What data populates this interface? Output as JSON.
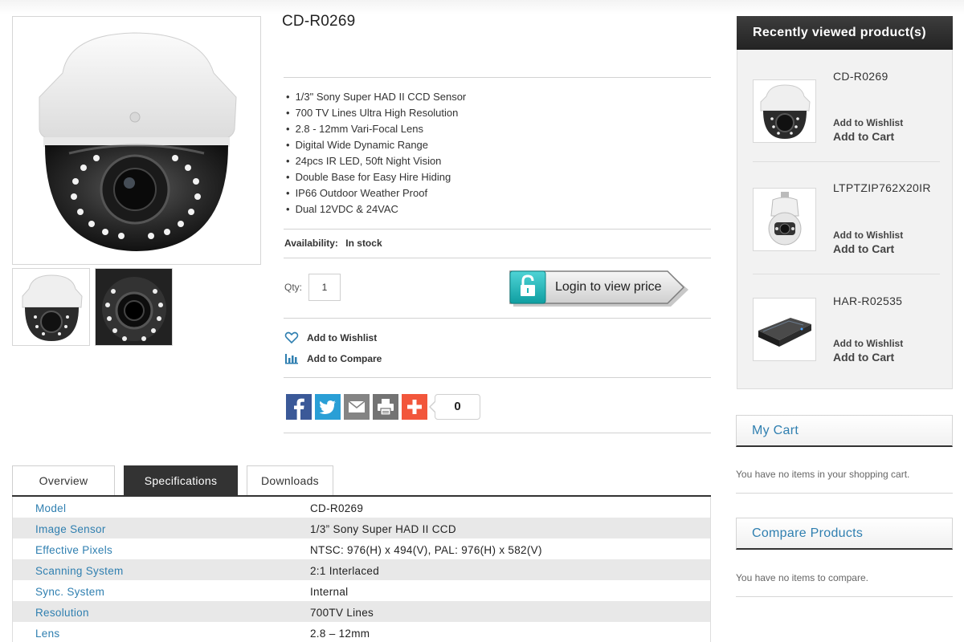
{
  "product": {
    "title": "CD-R0269",
    "features": [
      "1/3\" Sony Super HAD II CCD Sensor",
      "700 TV Lines Ultra High Resolution",
      "2.8 - 12mm Vari-Focal Lens",
      "Digital Wide Dynamic Range",
      "24pcs IR LED, 50ft Night Vision",
      "Double Base for Easy Hire Hiding",
      "IP66 Outdoor Weather Proof",
      "Dual 12VDC & 24VAC"
    ],
    "availability_label": "Availability:",
    "availability_value": "In stock",
    "qty_label": "Qty:",
    "qty_value": "1",
    "login_price_label": "Login to view price",
    "add_to_wishlist": "Add to Wishlist",
    "add_to_compare": "Add to Compare",
    "share_count": "0"
  },
  "share_icons": [
    "facebook-icon",
    "twitter-icon",
    "email-icon",
    "print-icon",
    "addthis-plus-icon"
  ],
  "colors": {
    "facebook": "#3b5998",
    "twitter": "#2a9fd6",
    "email": "#848484",
    "print": "#737373",
    "addthis": "#f2563b",
    "link_blue": "#2f7fb0",
    "tab_active": "#333333",
    "login_teal": "#19b6b9"
  },
  "tabs": [
    {
      "label": "Overview",
      "active": false
    },
    {
      "label": "Specifications",
      "active": true
    },
    {
      "label": "Downloads",
      "active": false
    }
  ],
  "specs": [
    {
      "key": "Model",
      "value": "CD-R0269"
    },
    {
      "key": "Image Sensor",
      "value": "1/3” Sony Super HAD II CCD"
    },
    {
      "key": "Effective Pixels",
      "value": "NTSC: 976(H) x 494(V), PAL: 976(H) x 582(V)"
    },
    {
      "key": "Scanning System",
      "value": "2:1 Interlaced"
    },
    {
      "key": "Sync. System",
      "value": "Internal"
    },
    {
      "key": "Resolution",
      "value": "700TV Lines"
    },
    {
      "key": "Lens",
      "value": "2.8 – 12mm"
    }
  ],
  "sidebar": {
    "recently_viewed_title": "Recently viewed product(s)",
    "recently_viewed": [
      {
        "name": "CD-R0269",
        "wishlist": "Add to Wishlist",
        "cart": "Add to Cart"
      },
      {
        "name": "LTPTZIP762X20IR",
        "wishlist": "Add to Wishlist",
        "cart": "Add to Cart"
      },
      {
        "name": "HAR-R02535",
        "wishlist": "Add to Wishlist",
        "cart": "Add to Cart"
      }
    ],
    "my_cart_title": "My Cart",
    "my_cart_text": "You have no items in your shopping cart.",
    "compare_title": "Compare Products",
    "compare_text": "You have no items to compare."
  }
}
